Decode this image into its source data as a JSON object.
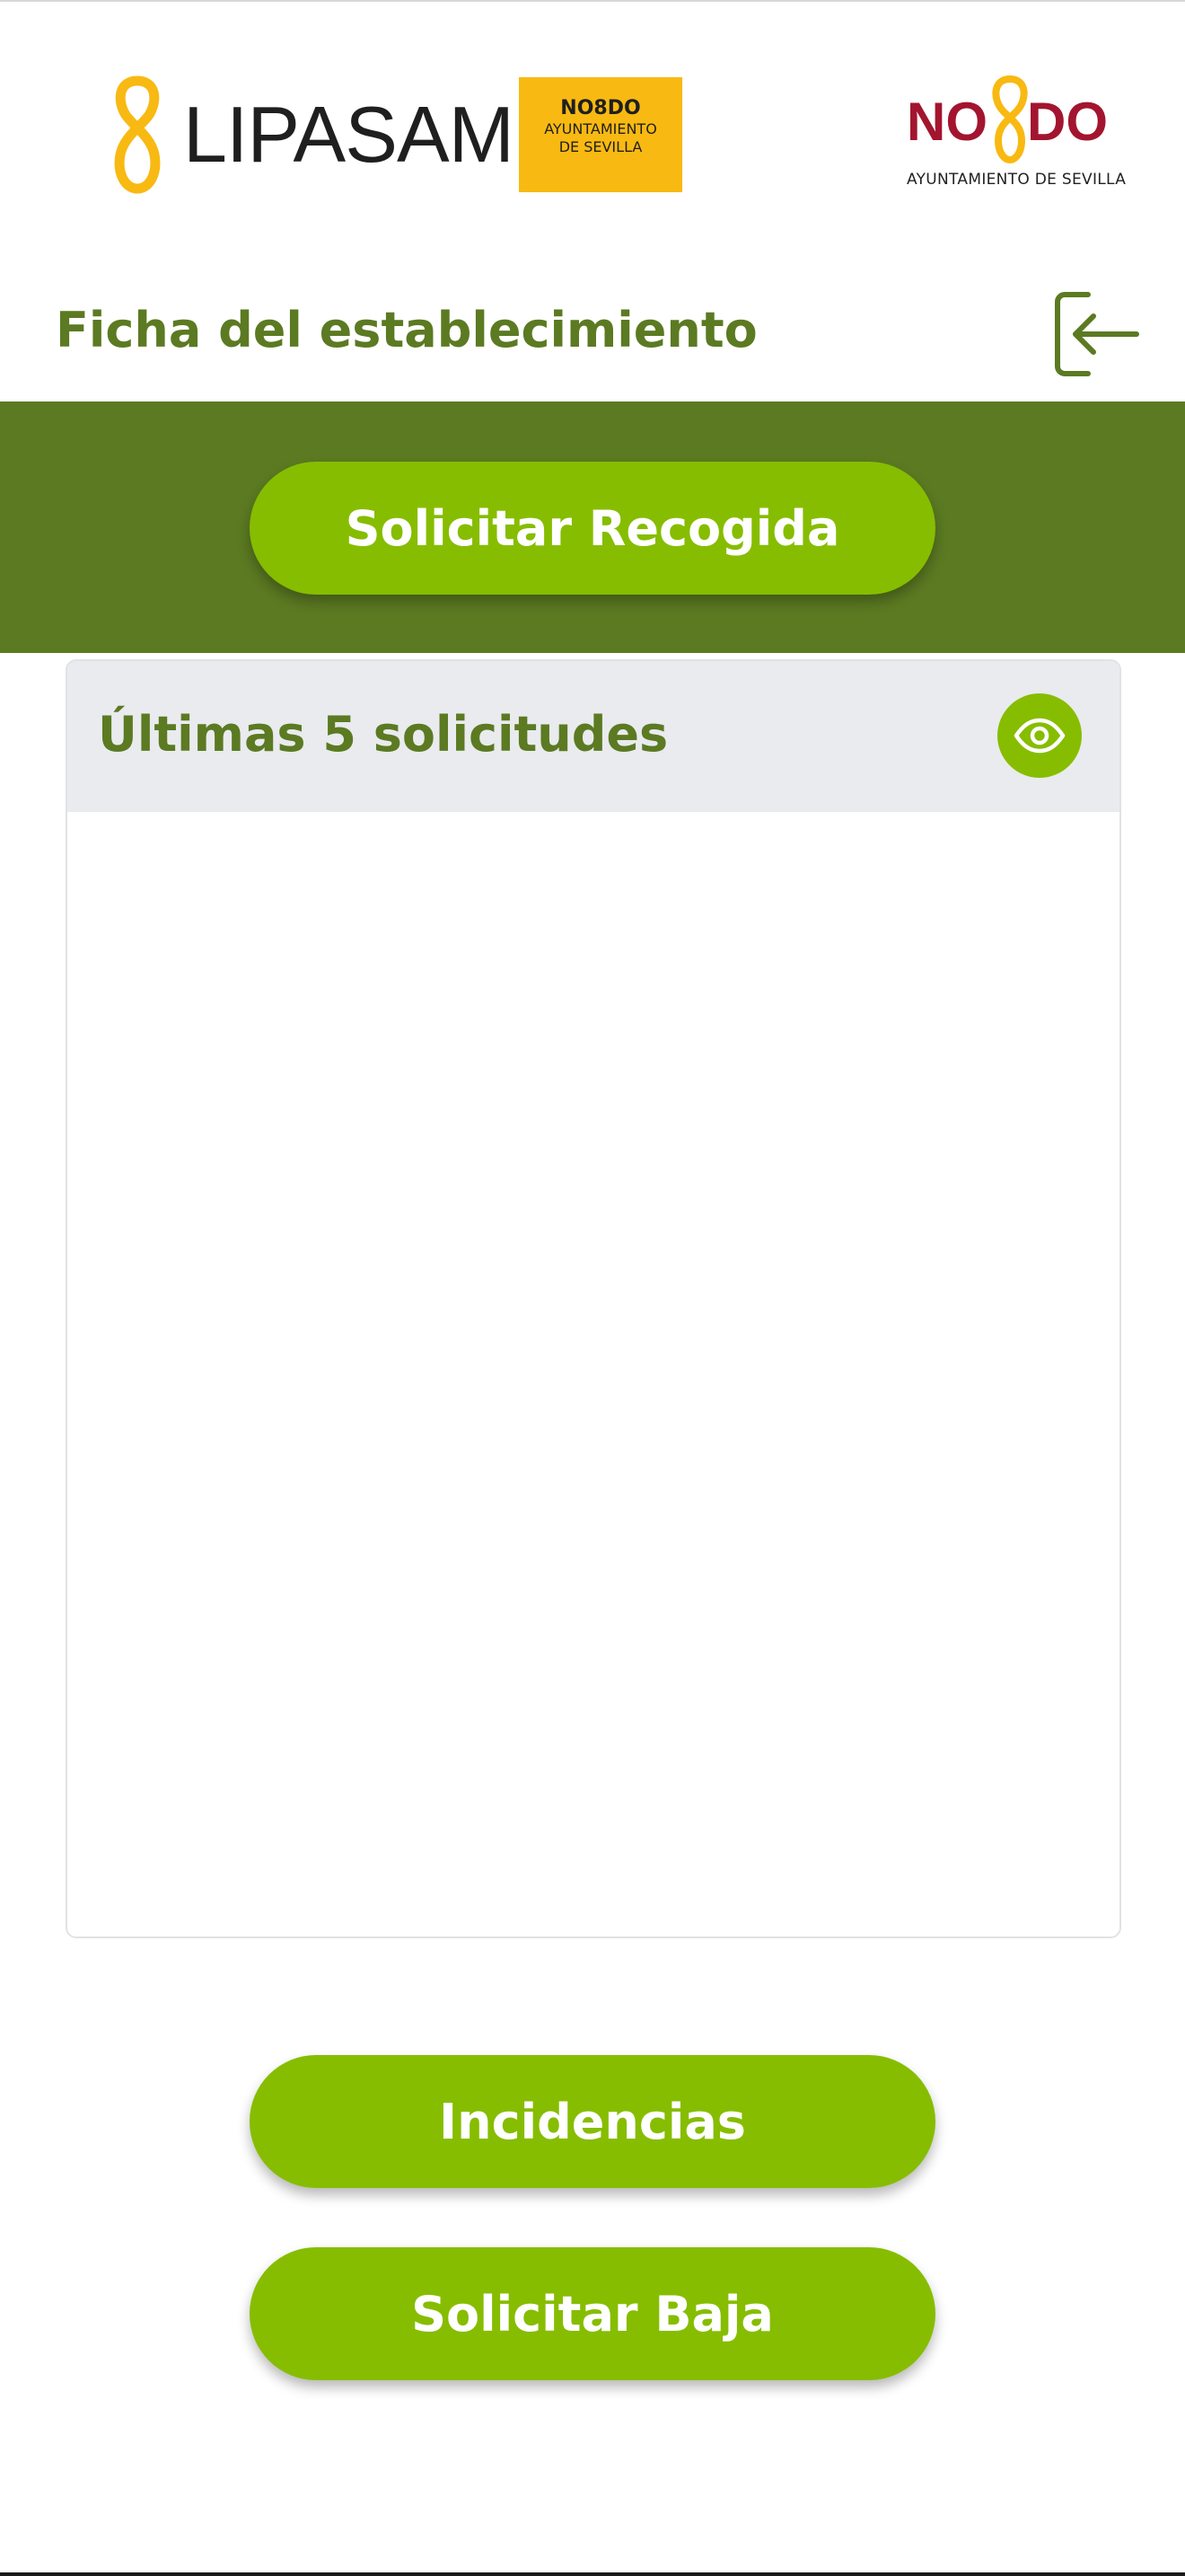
{
  "header": {
    "lipasam_text": "LIPASAM",
    "badge": {
      "no8do": "NO8DO",
      "line1": "AYUNTAMIENTO",
      "line2": "DE SEVILLA"
    },
    "nodo": {
      "text": "NO DO",
      "subtitle": "AYUNTAMIENTO DE SEVILLA"
    }
  },
  "page": {
    "title": "Ficha del establecimiento",
    "logout_icon": "logout-icon"
  },
  "actions": {
    "solicitar_recogida": "Solicitar Recogida",
    "incidencias": "Incidencias",
    "solicitar_baja": "Solicitar Baja"
  },
  "card": {
    "title": "Últimas 5 solicitudes",
    "view_icon": "eye-icon"
  },
  "colors": {
    "brand_green_dark": "#5b7a22",
    "brand_green_light": "#86bd00",
    "lipasam_yellow": "#f8b912",
    "nodo_red": "#a3152f"
  }
}
